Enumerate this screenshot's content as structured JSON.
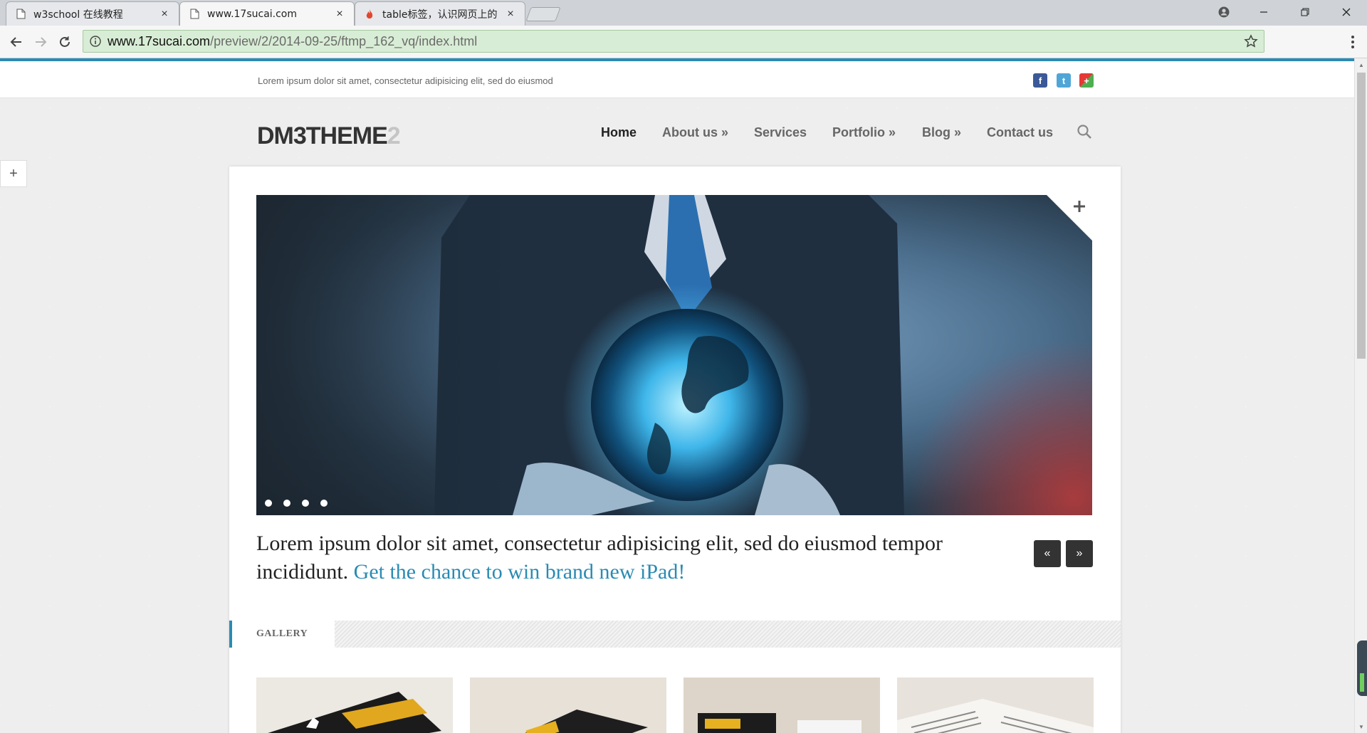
{
  "browser": {
    "tabs": [
      {
        "title": "w3school 在线教程",
        "icon": "page-icon",
        "active": false
      },
      {
        "title": "www.17sucai.com",
        "icon": "page-icon",
        "active": true
      },
      {
        "title": "table标签，认识网页上的",
        "icon": "flame-icon",
        "active": false
      }
    ],
    "close_glyph": "×",
    "url_host": "www.17sucai.com",
    "url_path": "/preview/2/2014-09-25/ftmp_162_vq/index.html",
    "omnibox_color": "#d8edd5"
  },
  "page": {
    "tagline": "Lorem ipsum dolor sit amet, consectetur adipisicing elit, sed do eiusmod",
    "social": [
      {
        "icon": "facebook-icon",
        "glyph": "f",
        "color": "#3b5998"
      },
      {
        "icon": "twitter-icon",
        "glyph": "t",
        "color": "#4fa6d6"
      },
      {
        "icon": "googleplus-icon",
        "glyph": "+",
        "color": "#4caf50"
      }
    ],
    "logo_main": "DM3THEME",
    "logo_num": "2",
    "nav": [
      {
        "label": "Home",
        "active": true
      },
      {
        "label": "About us »",
        "active": false
      },
      {
        "label": "Services",
        "active": false
      },
      {
        "label": "Portfolio »",
        "active": false
      },
      {
        "label": "Blog »",
        "active": false
      },
      {
        "label": "Contact us",
        "active": false
      }
    ],
    "side_plus": "+",
    "slider": {
      "plus": "+",
      "dots_count": 4,
      "prev": "«",
      "next": "»"
    },
    "headline_text": "Lorem ipsum dolor sit amet, consectetur adipisicing elit, sed do eiusmod tempor incididunt. ",
    "headline_link": "Get the chance to win brand new iPad!",
    "gallery_label": "GALLERY",
    "accent_color": "#2a8bb3"
  }
}
